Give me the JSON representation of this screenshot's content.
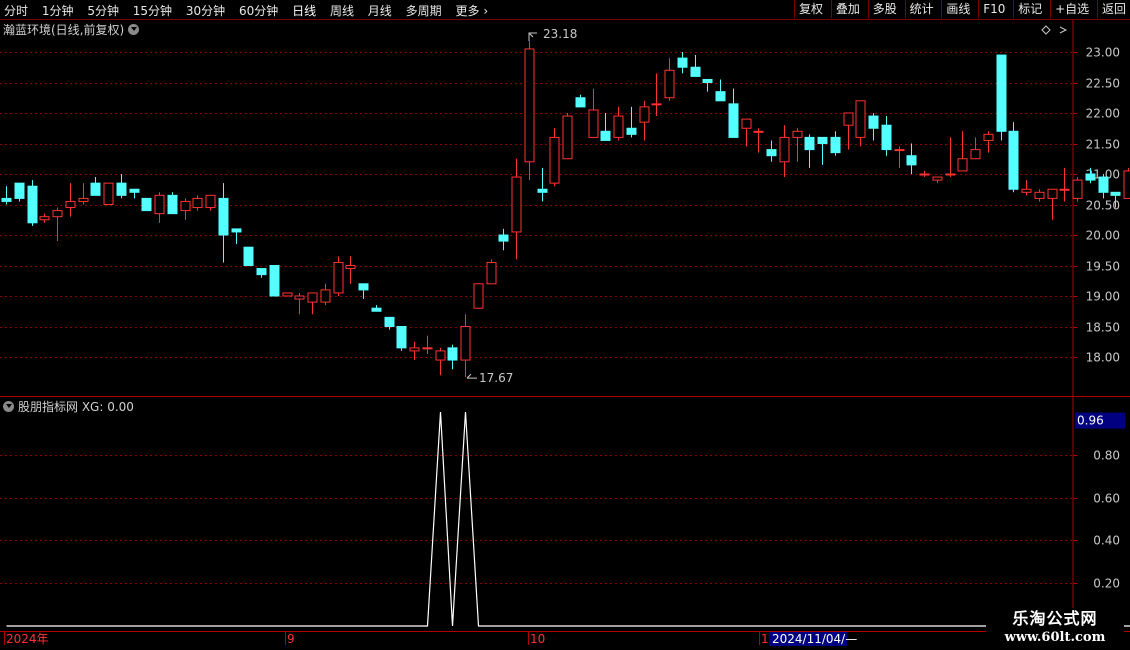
{
  "toolbar": {
    "periods": [
      "分时",
      "1分钟",
      "5分钟",
      "15分钟",
      "30分钟",
      "60分钟",
      "日线",
      "周线",
      "月线",
      "多周期",
      "更多"
    ],
    "active_period": "日线",
    "buttons": [
      "复权",
      "叠加",
      "多股",
      "统计",
      "画线",
      "F10",
      "标记",
      "+自选",
      "返回"
    ]
  },
  "main_title": "瀚蓝环境(日线,前复权)",
  "indicator_title": "股朋指标网 XG: 0.00",
  "colors": {
    "up": "#ff3232",
    "down": "#54ffff",
    "grid": "#8b0000",
    "axis_text": "#c8c8c8",
    "indicator_line": "#ffffff",
    "highlight": "#000080"
  },
  "chart_data": [
    {
      "type": "candlestick",
      "title": "瀚蓝环境(日线,前复权)",
      "yticks": [
        "23.00",
        "22.50",
        "22.00",
        "21.50",
        "21.00",
        "20.50",
        "20.00",
        "19.50",
        "19.00",
        "18.50",
        "18.00"
      ],
      "ylim": [
        17.4,
        23.3
      ],
      "max_label": "23.18",
      "min_label": "17.67",
      "candles": [
        [
          20.6,
          20.8,
          20.5,
          20.55
        ],
        [
          20.85,
          20.85,
          20.55,
          20.6
        ],
        [
          20.8,
          20.9,
          20.15,
          20.2
        ],
        [
          20.25,
          20.35,
          20.2,
          20.3
        ],
        [
          20.3,
          20.45,
          19.9,
          20.4
        ],
        [
          20.45,
          20.85,
          20.3,
          20.55
        ],
        [
          20.55,
          20.85,
          20.5,
          20.6
        ],
        [
          20.85,
          20.95,
          20.65,
          20.65
        ],
        [
          20.5,
          20.85,
          20.5,
          20.85
        ],
        [
          20.85,
          21.0,
          20.6,
          20.65
        ],
        [
          20.75,
          20.75,
          20.6,
          20.7
        ],
        [
          20.6,
          20.6,
          20.4,
          20.4
        ],
        [
          20.35,
          20.7,
          20.2,
          20.65
        ],
        [
          20.65,
          20.7,
          20.4,
          20.35
        ],
        [
          20.4,
          20.6,
          20.25,
          20.55
        ],
        [
          20.45,
          20.65,
          20.4,
          20.6
        ],
        [
          20.45,
          20.65,
          20.4,
          20.65
        ],
        [
          20.6,
          20.85,
          19.55,
          20.0
        ],
        [
          20.1,
          20.05,
          19.85,
          20.05
        ],
        [
          19.8,
          19.8,
          19.55,
          19.5
        ],
        [
          19.45,
          19.45,
          19.3,
          19.35
        ],
        [
          19.5,
          19.5,
          19.0,
          19.0
        ],
        [
          19.0,
          19.05,
          19.0,
          19.05
        ],
        [
          18.95,
          19.05,
          18.7,
          19.0
        ],
        [
          18.9,
          19.0,
          18.7,
          19.05
        ],
        [
          18.9,
          19.2,
          18.85,
          19.1
        ],
        [
          19.05,
          19.65,
          19.0,
          19.55
        ],
        [
          19.45,
          19.65,
          19.2,
          19.5
        ],
        [
          19.2,
          19.2,
          18.95,
          19.1
        ],
        [
          18.8,
          18.85,
          18.75,
          18.75
        ],
        [
          18.65,
          18.65,
          18.45,
          18.5
        ],
        [
          18.5,
          18.5,
          18.1,
          18.15
        ],
        [
          18.1,
          18.25,
          17.95,
          18.15
        ],
        [
          18.15,
          18.35,
          18.05,
          18.15
        ],
        [
          17.95,
          18.15,
          17.7,
          18.1
        ],
        [
          18.15,
          18.2,
          17.8,
          17.95
        ],
        [
          17.95,
          18.7,
          17.67,
          18.5
        ],
        [
          18.8,
          19.15,
          18.8,
          19.2
        ],
        [
          19.2,
          19.6,
          19.2,
          19.55
        ],
        [
          20.0,
          20.1,
          19.75,
          19.9
        ],
        [
          20.05,
          21.25,
          19.6,
          20.95
        ],
        [
          21.2,
          23.18,
          20.9,
          23.05
        ],
        [
          20.75,
          21.1,
          20.55,
          20.7
        ],
        [
          20.85,
          21.75,
          20.8,
          21.6
        ],
        [
          21.25,
          22.0,
          21.25,
          21.95
        ],
        [
          22.25,
          22.3,
          22.1,
          22.1
        ],
        [
          21.6,
          22.4,
          21.7,
          22.05
        ],
        [
          21.7,
          22.0,
          21.55,
          21.55
        ],
        [
          21.6,
          22.1,
          21.55,
          21.95
        ],
        [
          21.75,
          22.1,
          21.6,
          21.65
        ],
        [
          21.85,
          22.2,
          21.55,
          22.1
        ],
        [
          22.15,
          22.65,
          21.95,
          22.15
        ],
        [
          22.25,
          22.9,
          22.2,
          22.7
        ],
        [
          22.9,
          23.0,
          22.65,
          22.75
        ],
        [
          22.75,
          22.95,
          22.7,
          22.6
        ],
        [
          22.55,
          22.5,
          22.35,
          22.5
        ],
        [
          22.35,
          22.55,
          22.2,
          22.2
        ],
        [
          22.15,
          22.4,
          21.9,
          21.6
        ],
        [
          21.75,
          21.9,
          21.45,
          21.9
        ],
        [
          21.7,
          21.75,
          21.35,
          21.7
        ],
        [
          21.4,
          21.55,
          21.2,
          21.3
        ],
        [
          21.2,
          21.8,
          20.95,
          21.6
        ],
        [
          21.6,
          21.75,
          21.2,
          21.7
        ],
        [
          21.6,
          21.65,
          21.1,
          21.4
        ],
        [
          21.6,
          21.55,
          21.15,
          21.5
        ],
        [
          21.6,
          21.7,
          21.3,
          21.35
        ],
        [
          21.8,
          22.0,
          21.4,
          22.0
        ],
        [
          21.6,
          22.2,
          21.45,
          22.2
        ],
        [
          21.95,
          22.0,
          21.55,
          21.75
        ],
        [
          21.8,
          21.95,
          21.3,
          21.4
        ],
        [
          21.4,
          21.45,
          21.1,
          21.4
        ],
        [
          21.3,
          21.5,
          21.0,
          21.15
        ],
        [
          21.0,
          21.05,
          20.95,
          21.0
        ],
        [
          20.9,
          20.95,
          20.85,
          20.95
        ],
        [
          21.0,
          21.6,
          20.95,
          21.0
        ],
        [
          21.05,
          21.7,
          21.1,
          21.25
        ],
        [
          21.25,
          21.6,
          21.3,
          21.4
        ],
        [
          21.55,
          21.7,
          21.35,
          21.65
        ],
        [
          22.95,
          22.9,
          21.55,
          21.7
        ],
        [
          21.7,
          21.85,
          20.7,
          20.75
        ],
        [
          20.7,
          20.9,
          20.65,
          20.75
        ],
        [
          20.6,
          20.75,
          20.55,
          20.7
        ],
        [
          20.6,
          20.75,
          20.25,
          20.75
        ],
        [
          20.75,
          21.1,
          20.55,
          20.75
        ],
        [
          20.6,
          20.95,
          20.55,
          20.9
        ],
        [
          21.0,
          21.1,
          20.85,
          20.9
        ],
        [
          20.95,
          21.0,
          20.6,
          20.7
        ],
        [
          20.7,
          20.7,
          20.45,
          20.65
        ],
        [
          20.6,
          21.1,
          20.7,
          21.05
        ],
        [
          21.1,
          21.65,
          20.55,
          20.6
        ]
      ],
      "indicator": {
        "name": "XG",
        "value": "0.00",
        "current_label": "0.96",
        "yticks": [
          "0.80",
          "0.60",
          "0.40",
          "0.20"
        ],
        "ylim": [
          0,
          1.0
        ],
        "values": [
          0,
          0,
          0,
          0,
          0,
          0,
          0,
          0,
          0,
          0,
          0,
          0,
          0,
          0,
          0,
          0,
          0,
          0,
          0,
          0,
          0,
          0,
          0,
          0,
          0,
          0,
          0,
          0,
          0,
          0,
          0,
          0,
          0,
          0,
          1,
          0,
          1,
          0,
          0,
          0,
          0,
          0,
          0,
          0,
          0,
          0,
          0,
          0,
          0,
          0,
          0,
          0,
          0,
          0,
          0,
          0,
          0,
          0,
          0,
          0,
          0,
          0,
          0,
          0,
          0,
          0,
          0,
          0,
          0,
          0,
          0,
          0,
          0,
          0,
          0,
          0,
          0,
          0,
          0,
          0,
          0,
          0,
          0,
          0,
          0,
          0,
          0,
          0,
          0,
          0
        ]
      },
      "x_axis": [
        "2024年",
        "9",
        "10",
        "1",
        "2024/11/04/—"
      ]
    }
  ],
  "watermark": {
    "line1": "乐淘公式网",
    "line2": "www.60lt.com"
  }
}
